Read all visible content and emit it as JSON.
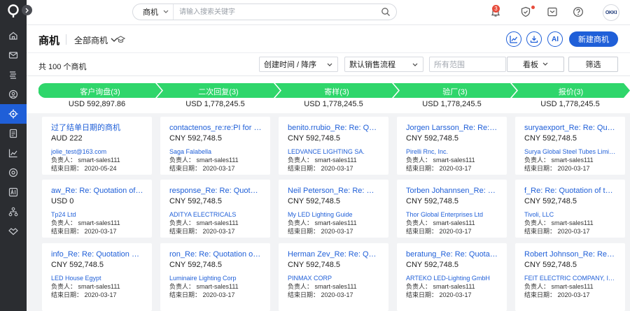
{
  "topbar": {
    "search_scope": "商机",
    "search_placeholder": "请输入搜索关键字",
    "notification_count": "3",
    "avatar_text": "OKKI"
  },
  "header": {
    "title": "商机",
    "view_label": "全部商机",
    "ai_label": "AI",
    "create_label": "新建商机"
  },
  "filters": {
    "total": "共 100 个商机",
    "sort": "创建时间 / 降序",
    "process": "默认销售流程",
    "scope_placeholder": "所有范围",
    "view_mode": "看板",
    "filter_label": "筛选"
  },
  "stages": [
    {
      "label": "客户询盘(3)",
      "amount": "USD 592,897.86"
    },
    {
      "label": "二次回复(3)",
      "amount": "USD 1,778,245.5"
    },
    {
      "label": "寄样(3)",
      "amount": "USD 1,778,245.5"
    },
    {
      "label": "验厂(3)",
      "amount": "USD 1,778,245.5"
    },
    {
      "label": "报价(3)",
      "amount": "USD 1,778,245.5"
    }
  ],
  "cards": [
    [
      {
        "title": "过了结单日期的商机",
        "amount": "AUD 222",
        "company": "jolie_test@163.com",
        "owner": "负责人： smart-sales111",
        "end": "结束日期： 2020-05-24"
      },
      {
        "title": "aw_Re: Re: Quotation of the art...",
        "amount": "USD 0",
        "company": "Tp24 Ltd",
        "owner": "负责人： smart-sales111",
        "end": "结束日期： 2020-03-17"
      },
      {
        "title": "info_Re: Re: Quotation of the a...",
        "amount": "CNY 592,748.5",
        "company": "LED House Egypt",
        "owner": "负责人： smart-sales111",
        "end": "结束日期： 2020-03-17"
      }
    ],
    [
      {
        "title": "contactenos_re:re:PI for mike",
        "amount": "CNY 592,748.5",
        "company": "Saga Falabella",
        "owner": "负责人： smart-sales111",
        "end": "结束日期： 2020-03-17"
      },
      {
        "title": "response_Re: Re: Quotation of...",
        "amount": "CNY 592,748.5",
        "company": "ADITYA ELECTRICALS",
        "owner": "负责人： smart-sales111",
        "end": "结束日期： 2020-03-17"
      },
      {
        "title": "ron_Re: Re: Quotation of the a...",
        "amount": "CNY 592,748.5",
        "company": "Luminaire Lighting Corp",
        "owner": "负责人： smart-sales111",
        "end": "结束日期： 2020-03-17"
      }
    ],
    [
      {
        "title": "benito.rrubio_Re: Re: Quotation...",
        "amount": "CNY 592,748.5",
        "company": "LEDVANCE LIGHTING SA.",
        "owner": "负责人： smart-sales111",
        "end": "结束日期： 2020-03-17"
      },
      {
        "title": "Neil Peterson_Re: Re: Quotatio...",
        "amount": "CNY 592,748.5",
        "company": "My LED Lighting Guide",
        "owner": "负责人： smart-sales111",
        "end": "结束日期： 2020-03-17"
      },
      {
        "title": "Herman Zev_Re: Re: Quotation...",
        "amount": "CNY 592,748.5",
        "company": "PINMAX CORP",
        "owner": "负责人： smart-sales111",
        "end": "结束日期： 2020-03-17"
      }
    ],
    [
      {
        "title": "Jorgen Larsson_Re: Re: Quotat...",
        "amount": "CNY 592,748.5",
        "company": "Pirelli Rnc, Inc.",
        "owner": "负责人： smart-sales111",
        "end": "结束日期： 2020-03-17"
      },
      {
        "title": "Torben Johannsen_Re: Re: Quo...",
        "amount": "CNY 592,748.5",
        "company": "Thor Global Enterprises Ltd",
        "owner": "负责人： smart-sales111",
        "end": "结束日期： 2020-03-17"
      },
      {
        "title": "beratung_Re: Re: Quotation of...",
        "amount": "CNY 592,748.5",
        "company": "ARTEKO LED-Lighting GmbH",
        "owner": "负责人： smart-sales111",
        "end": "结束日期： 2020-03-17"
      }
    ],
    [
      {
        "title": "suryaexport_Re: Re: Quotation...",
        "amount": "CNY 592,748.5",
        "company": "Surya Global Steel Tubes Limited",
        "owner": "负责人： smart-sales111",
        "end": "结束日期： 2020-03-17"
      },
      {
        "title": "f_Re: Re: Quotation of the art ...",
        "amount": "CNY 592,748.5",
        "company": "Tivoli, LLC",
        "owner": "负责人： smart-sales111",
        "end": "结束日期： 2020-03-17"
      },
      {
        "title": "Robert Johnson_Re: Re: Quota...",
        "amount": "CNY 592,748.5",
        "company": "FEIT ELECTRIC COMPANY, INC.",
        "owner": "负责人： smart-sales111",
        "end": "结束日期： 2020-03-17"
      }
    ]
  ],
  "colors": {
    "accent": "#1f5fd8",
    "stage_green": "#2fd66b",
    "rail_bg": "#2b2d31"
  },
  "rail_icons": [
    "home-icon",
    "mail-icon",
    "library-icon",
    "contacts-icon",
    "opportunity-icon",
    "document-icon",
    "analytics-icon",
    "settings-icon",
    "ai-icon",
    "org-chart-icon",
    "handshake-icon"
  ]
}
